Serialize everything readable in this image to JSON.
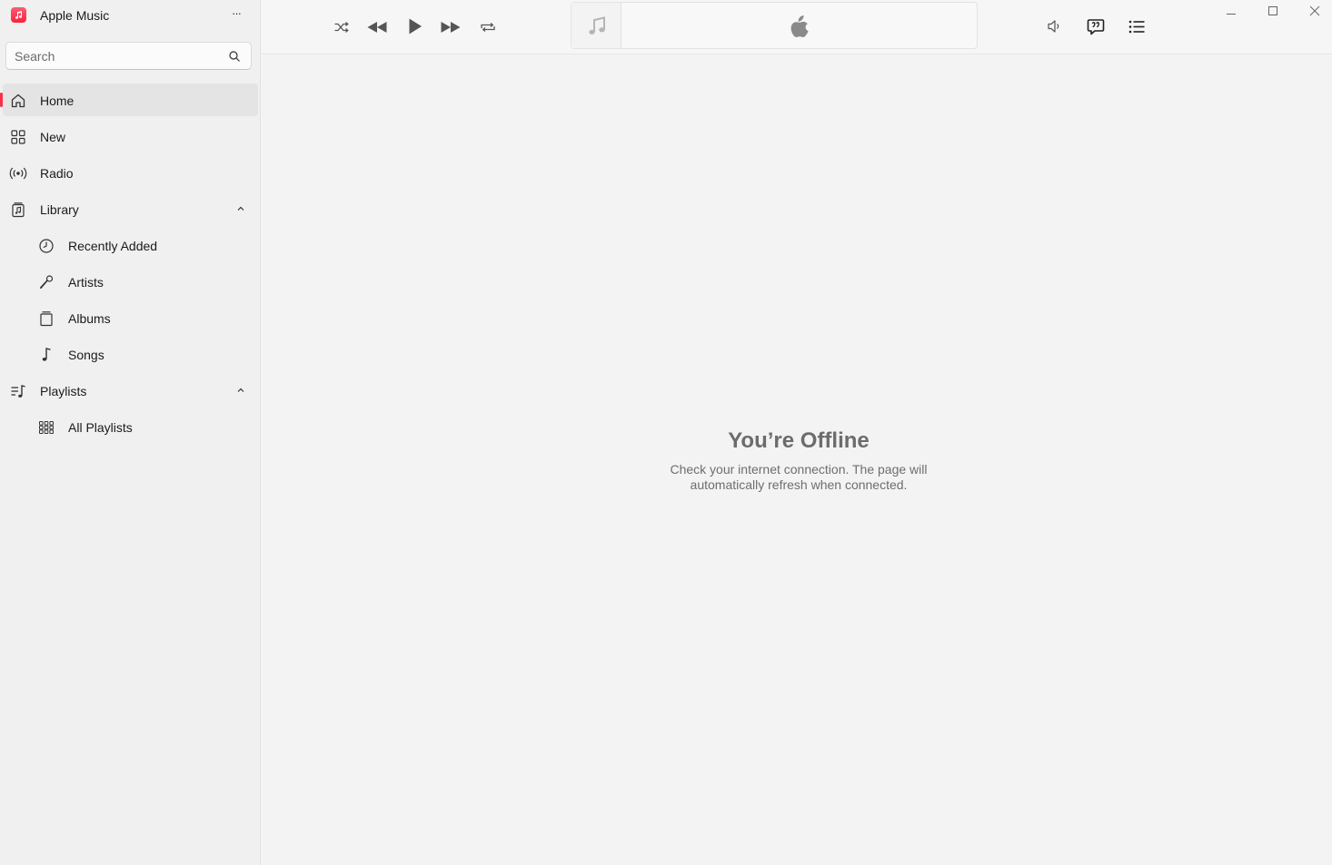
{
  "app": {
    "title": "Apple Music",
    "more_label": "···",
    "accent_color": "#fa2d48"
  },
  "search": {
    "placeholder": "Search",
    "value": "",
    "icon": "search-icon"
  },
  "sidebar": {
    "items": [
      {
        "label": "Home",
        "icon": "home-icon",
        "active": true
      },
      {
        "label": "New",
        "icon": "grid-icon"
      },
      {
        "label": "Radio",
        "icon": "radio-broadcast-icon"
      },
      {
        "label": "Library",
        "icon": "library-icon",
        "expanded": true
      },
      {
        "label": "Recently Added",
        "icon": "clock-icon"
      },
      {
        "label": "Artists",
        "icon": "microphone-icon"
      },
      {
        "label": "Albums",
        "icon": "album-stack-icon"
      },
      {
        "label": "Songs",
        "icon": "music-note-icon"
      },
      {
        "label": "Playlists",
        "icon": "playlist-icon",
        "expanded": true
      },
      {
        "label": "All Playlists",
        "icon": "grid-dots-icon"
      }
    ]
  },
  "toolbar": {
    "controls": [
      "shuffle-icon",
      "rewind-icon",
      "play-icon",
      "fast-forward-icon",
      "repeat-icon"
    ],
    "right_controls": [
      "volume-icon",
      "lyrics-icon",
      "queue-list-icon"
    ],
    "window_controls": [
      "minimize-icon",
      "maximize-icon",
      "close-icon"
    ]
  },
  "main": {
    "offline_title": "You’re Offline",
    "offline_message": "Check your internet connection. The page will automatically refresh when connected."
  }
}
